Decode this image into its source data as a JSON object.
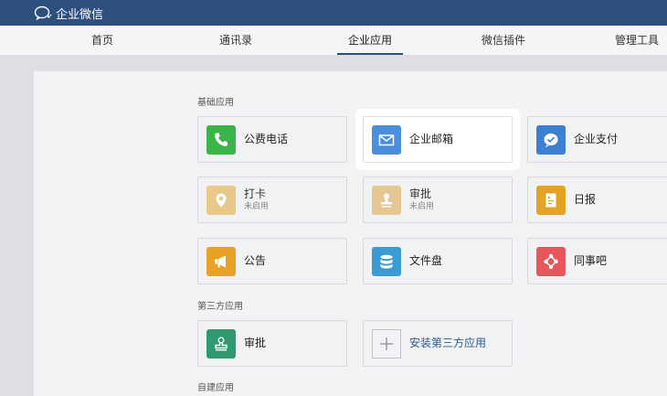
{
  "brand": {
    "name": "企业微信"
  },
  "nav": {
    "tabs": [
      {
        "label": "首页"
      },
      {
        "label": "通讯录"
      },
      {
        "label": "企业应用"
      },
      {
        "label": "微信插件"
      },
      {
        "label": "管理工具"
      }
    ],
    "active": "企业应用"
  },
  "sections": {
    "basic": {
      "title": "基础应用",
      "apps": [
        {
          "label": "公费电话",
          "sub": "",
          "icon": "phone-icon",
          "color": "#3bb54a"
        },
        {
          "label": "企业邮箱",
          "sub": "",
          "icon": "mail-icon",
          "color": "#4a8fdb"
        },
        {
          "label": "企业支付",
          "sub": "",
          "icon": "pay-icon",
          "color": "#3d7fd1"
        },
        {
          "label": "打卡",
          "sub": "未启用",
          "icon": "location-pin-icon",
          "color": "#e8c98a"
        },
        {
          "label": "审批",
          "sub": "未启用",
          "icon": "stamp-icon",
          "color": "#e6c793"
        },
        {
          "label": "日报",
          "sub": "",
          "icon": "report-icon",
          "color": "#e5a323"
        },
        {
          "label": "公告",
          "sub": "",
          "icon": "megaphone-icon",
          "color": "#e8a226"
        },
        {
          "label": "文件盘",
          "sub": "",
          "icon": "database-icon",
          "color": "#3c9ad5"
        },
        {
          "label": "同事吧",
          "sub": "",
          "icon": "network-icon",
          "color": "#e5575a"
        }
      ]
    },
    "third_party": {
      "title": "第三方应用",
      "apps": [
        {
          "label": "审批",
          "sub": "",
          "icon": "stamp-icon",
          "color": "#2e9a6e"
        }
      ],
      "install_label": "安装第三方应用"
    },
    "custom": {
      "title": "自建应用"
    }
  }
}
